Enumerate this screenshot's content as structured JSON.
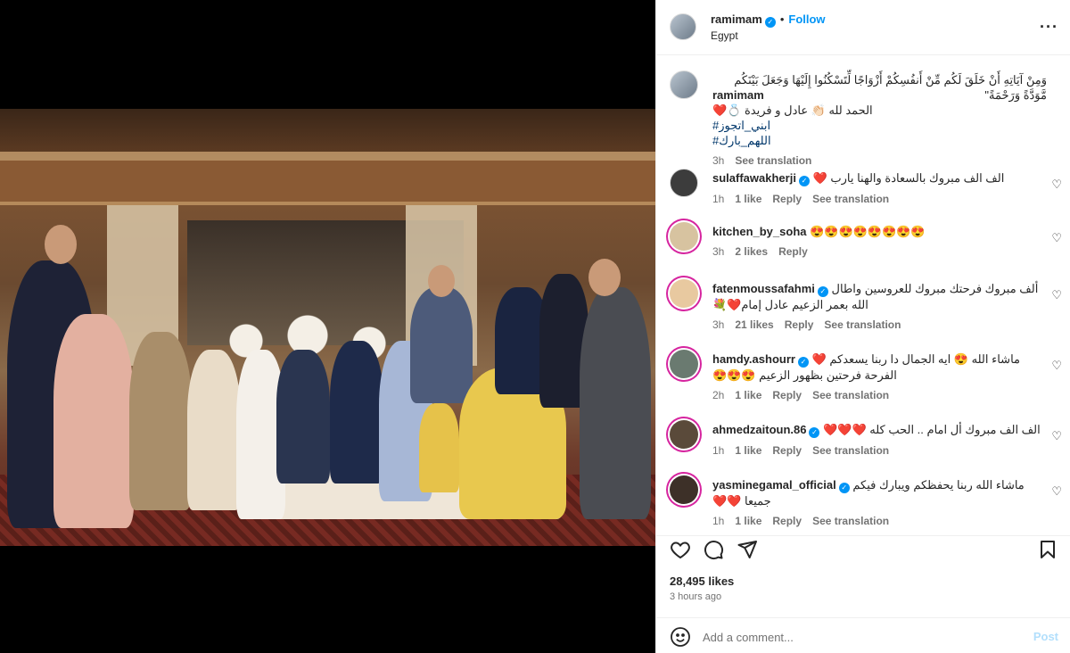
{
  "post": {
    "username": "ramimam",
    "follow_label": "Follow",
    "dot": "•",
    "location": "Egypt",
    "more_icon": "more-horizontal-icon"
  },
  "caption": {
    "username": "ramimam",
    "text_line1": "وَمِنْ آيَاتِهِ أَنْ خَلَقَ لَكُم مِّنْ أَنفُسِكُمْ أَزْوَاجًا لِّتَسْكُنُوا إِلَيْهَا وَجَعَلَ بَيْنَكُم مَّوَدَّةً وَرَحْمَةً\"",
    "text_line2": "الحمد لله 👏🏻 عادل و فريدة 💍❤️",
    "hashtag1": "#ابني_اتجوز",
    "hashtag2": "#اللهم_بارك",
    "time": "3h",
    "see_translation": "See translation"
  },
  "comments": [
    {
      "username": "sulaffawakherji",
      "verified": true,
      "text": "الف الف مبروك بالسعادة والهنا يارب ❤️",
      "time": "1h",
      "likes": "1 like",
      "reply": "Reply",
      "translation": "See translation"
    },
    {
      "username": "kitchen_by_soha",
      "verified": false,
      "text": "😍😍😍😍😍😍😍😍",
      "time": "3h",
      "likes": "2 likes",
      "reply": "Reply",
      "translation": ""
    },
    {
      "username": "fatenmoussafahmi",
      "verified": true,
      "text": "ألف مبروك فرحتك مبروك للعروسين واطال الله بعمر الزعيم عادل إمام❤️💐",
      "time": "3h",
      "likes": "21 likes",
      "reply": "Reply",
      "translation": "See translation"
    },
    {
      "username": "hamdy.ashourr",
      "verified": true,
      "text": "ماشاء الله 😍 ايه الجمال دا ربنا يسعدكم ❤️ الفرحة فرحتين بظهور الزعيم 😍😍😍",
      "time": "2h",
      "likes": "1 like",
      "reply": "Reply",
      "translation": "See translation"
    },
    {
      "username": "ahmedzaitoun.86",
      "verified": true,
      "text": "الف الف مبروك أل امام .. الحب كله ❤️❤️❤️",
      "time": "1h",
      "likes": "1 like",
      "reply": "Reply",
      "translation": "See translation"
    },
    {
      "username": "yasminegamal_official",
      "verified": true,
      "text": "ماشاء الله ربنا يحفظكم ويبارك فيكم جميعا ❤️❤️",
      "time": "1h",
      "likes": "1 like",
      "reply": "Reply",
      "translation": "See translation"
    }
  ],
  "stats": {
    "likes": "28,495 likes",
    "ago": "3 hours ago"
  },
  "composer": {
    "placeholder": "Add a comment...",
    "post_label": "Post"
  },
  "icons": {
    "like": "heart-icon",
    "comment": "comment-icon",
    "share": "share-icon",
    "save": "bookmark-icon",
    "emoji": "emoji-icon"
  },
  "colors": {
    "accent": "#0095f6",
    "heart": "#ed4956",
    "muted": "#737373",
    "post_disabled": "#b2dffc"
  }
}
